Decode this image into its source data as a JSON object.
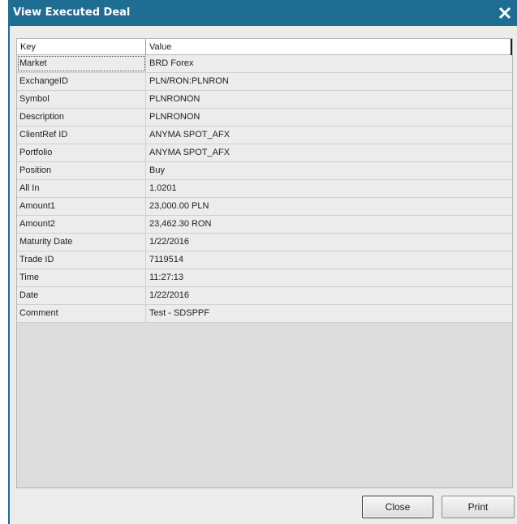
{
  "window": {
    "title": "View Executed Deal"
  },
  "grid": {
    "columns": [
      "Key",
      "Value"
    ],
    "rows": [
      {
        "key": "Market",
        "value": "BRD Forex"
      },
      {
        "key": "ExchangeID",
        "value": "PLN/RON:PLNRON"
      },
      {
        "key": "Symbol",
        "value": "PLNRONON"
      },
      {
        "key": "Description",
        "value": "PLNRONON"
      },
      {
        "key": "ClientRef ID",
        "value": "ANYMA SPOT_AFX"
      },
      {
        "key": "Portfolio",
        "value": "ANYMA SPOT_AFX"
      },
      {
        "key": "Position",
        "value": "Buy"
      },
      {
        "key": "All In",
        "value": "1.0201"
      },
      {
        "key": "Amount1",
        "value": "23,000.00 PLN"
      },
      {
        "key": "Amount2",
        "value": "23,462.30 RON"
      },
      {
        "key": "Maturity Date",
        "value": "1/22/2016"
      },
      {
        "key": "Trade ID",
        "value": "7119514"
      },
      {
        "key": "Time",
        "value": "11:27:13"
      },
      {
        "key": "Date",
        "value": "1/22/2016"
      },
      {
        "key": "Comment",
        "value": "Test - SDSPPF"
      }
    ]
  },
  "buttons": {
    "close_label": "Close",
    "print_label": "Print"
  },
  "colors": {
    "titlebar": "#1e6e93",
    "window_bg": "#ececec",
    "grid_bg": "#dcdcdc"
  }
}
